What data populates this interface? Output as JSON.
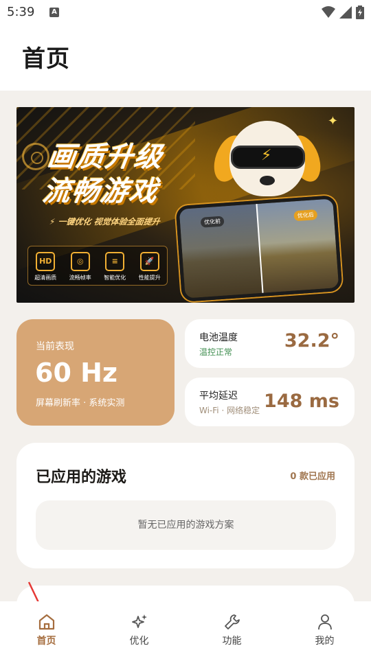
{
  "status_bar": {
    "time": "5:39",
    "notification_icon": "A"
  },
  "header": {
    "title": "首页"
  },
  "banner": {
    "title_line1": "画质升级",
    "title_line2": "流畅游戏",
    "subtitle": "⚡ 一键优化 视觉体验全面提升",
    "features": [
      {
        "icon": "HD",
        "label": "超清画质"
      },
      {
        "icon": "◎",
        "label": "流畅帧率"
      },
      {
        "icon": "≡",
        "label": "智能优化"
      },
      {
        "icon": "🚀",
        "label": "性能提升"
      }
    ],
    "before_tag": "优化前",
    "after_tag": "优化后"
  },
  "refresh_card": {
    "label": "当前表现",
    "value": "60 Hz",
    "desc": "屏幕刷新率 · 系统实测"
  },
  "temp_card": {
    "title": "电池温度",
    "sub": "温控正常",
    "value": "32.2°",
    "sub_color": "#3f8d4f"
  },
  "latency_card": {
    "title": "平均延迟",
    "sub": "Wi-Fi · 网络稳定",
    "value": "148 ms"
  },
  "games": {
    "title": "已应用的游戏",
    "count": "0 款已应用",
    "empty": "暂无已应用的游戏方案"
  },
  "nav": {
    "active": 0,
    "items": [
      {
        "label": "首页",
        "icon": "home-icon"
      },
      {
        "label": "优化",
        "icon": "sparkle-icon"
      },
      {
        "label": "功能",
        "icon": "wrench-icon"
      },
      {
        "label": "我的",
        "icon": "person-icon"
      }
    ]
  },
  "colors": {
    "accent": "#a56d3e",
    "hz_card": "#d7a675",
    "value_brown": "#9a6a41",
    "background": "#f3f0ec"
  }
}
